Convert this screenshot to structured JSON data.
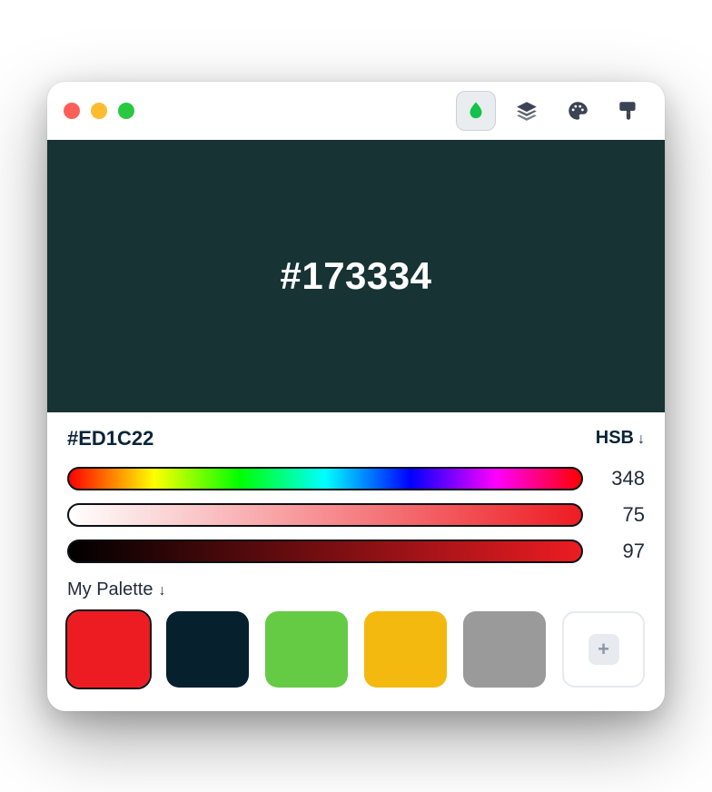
{
  "titlebar": {
    "tools": [
      {
        "name": "drop-icon",
        "active": true
      },
      {
        "name": "layers-icon",
        "active": false
      },
      {
        "name": "palette-icon",
        "active": false
      },
      {
        "name": "brush-icon",
        "active": false
      }
    ]
  },
  "preview": {
    "hex_display": "#173334",
    "bg": "#173334",
    "text_color": "#ffffff"
  },
  "editor": {
    "hex_label": "#ED1C22",
    "mode_label": "HSB",
    "sliders": {
      "hue": {
        "value": "348"
      },
      "saturation": {
        "value": "75"
      },
      "brightness": {
        "value": "97"
      }
    }
  },
  "palette": {
    "title": "My Palette",
    "swatches": [
      {
        "color": "#ED1C22",
        "selected": true
      },
      {
        "color": "#06202E",
        "selected": false
      },
      {
        "color": "#66CB44",
        "selected": false
      },
      {
        "color": "#F3B90F",
        "selected": false
      },
      {
        "color": "#9A9A9A",
        "selected": false
      }
    ],
    "add_label": "+"
  }
}
